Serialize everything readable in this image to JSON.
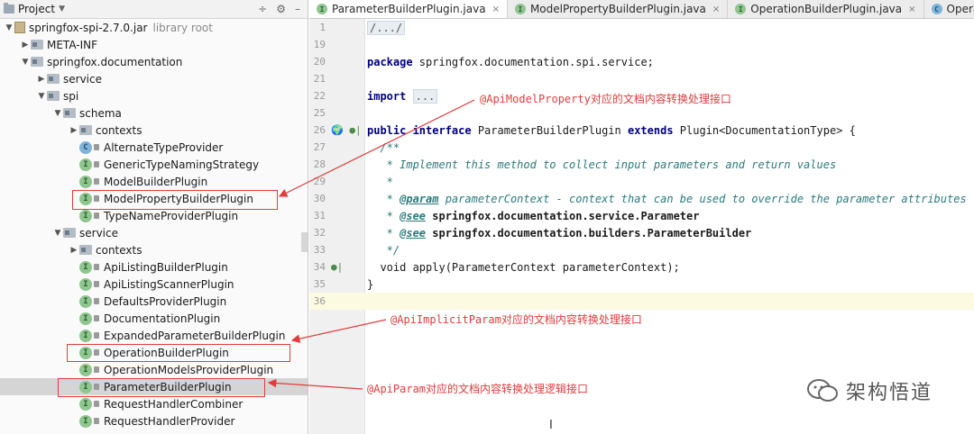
{
  "panel": {
    "title": "Project",
    "tools": [
      "÷",
      "⚙",
      "–"
    ]
  },
  "tree": [
    {
      "label": "springfox-spi-2.7.0.jar",
      "suffix": "library root",
      "type": "jar",
      "level": 0,
      "arrow": "down"
    },
    {
      "label": "META-INF",
      "type": "pkg",
      "level": 1,
      "arrow": "right"
    },
    {
      "label": "springfox.documentation",
      "type": "pkg",
      "level": 1,
      "arrow": "down"
    },
    {
      "label": "service",
      "type": "pkg",
      "level": 2,
      "arrow": "right"
    },
    {
      "label": "spi",
      "type": "pkg",
      "level": 2,
      "arrow": "down"
    },
    {
      "label": "schema",
      "type": "pkg",
      "level": 3,
      "arrow": "down"
    },
    {
      "label": "contexts",
      "type": "pkg",
      "level": 4,
      "arrow": "right"
    },
    {
      "label": "AlternateTypeProvider",
      "type": "class",
      "level": 4,
      "arrow": "none"
    },
    {
      "label": "GenericTypeNamingStrategy",
      "type": "interface",
      "level": 4,
      "arrow": "none"
    },
    {
      "label": "ModelBuilderPlugin",
      "type": "interface",
      "level": 4,
      "arrow": "none"
    },
    {
      "label": "ModelPropertyBuilderPlugin",
      "type": "interface",
      "level": 4,
      "arrow": "none"
    },
    {
      "label": "TypeNameProviderPlugin",
      "type": "interface",
      "level": 4,
      "arrow": "none"
    },
    {
      "label": "service",
      "type": "pkg",
      "level": 3,
      "arrow": "down"
    },
    {
      "label": "contexts",
      "type": "pkg",
      "level": 4,
      "arrow": "right"
    },
    {
      "label": "ApiListingBuilderPlugin",
      "type": "interface",
      "level": 4,
      "arrow": "none"
    },
    {
      "label": "ApiListingScannerPlugin",
      "type": "interface",
      "level": 4,
      "arrow": "none"
    },
    {
      "label": "DefaultsProviderPlugin",
      "type": "interface",
      "level": 4,
      "arrow": "none"
    },
    {
      "label": "DocumentationPlugin",
      "type": "interface",
      "level": 4,
      "arrow": "none"
    },
    {
      "label": "ExpandedParameterBuilderPlugin",
      "type": "interface",
      "level": 4,
      "arrow": "none"
    },
    {
      "label": "OperationBuilderPlugin",
      "type": "interface",
      "level": 4,
      "arrow": "none"
    },
    {
      "label": "OperationModelsProviderPlugin",
      "type": "interface",
      "level": 4,
      "arrow": "none"
    },
    {
      "label": "ParameterBuilderPlugin",
      "type": "interface",
      "level": 4,
      "arrow": "none",
      "selected": true
    },
    {
      "label": "RequestHandlerCombiner",
      "type": "interface",
      "level": 4,
      "arrow": "none"
    },
    {
      "label": "RequestHandlerProvider",
      "type": "interface",
      "level": 4,
      "arrow": "none"
    }
  ],
  "tabs": [
    {
      "label": "ParameterBuilderPlugin.java",
      "active": true,
      "icon": "interface"
    },
    {
      "label": "ModelPropertyBuilderPlugin.java",
      "active": false,
      "icon": "interface"
    },
    {
      "label": "OperationBuilderPlugin.java",
      "active": false,
      "icon": "interface"
    },
    {
      "label": "OperationImplicitParam",
      "active": false,
      "icon": "class"
    }
  ],
  "code_lines": [
    {
      "n": "1",
      "html": "<span class=\"fold\">/.../</span>"
    },
    {
      "n": "19",
      "html": ""
    },
    {
      "n": "20",
      "html": "<span class=\"kw\">package</span> springfox.documentation.spi.service;"
    },
    {
      "n": "21",
      "html": ""
    },
    {
      "n": "22",
      "html": "<span class=\"kw\">import</span> <span class=\"fold\">...</span>"
    },
    {
      "n": "25",
      "html": ""
    },
    {
      "n": "26",
      "html": "<span class=\"kw\">public interface</span> ParameterBuilderPlugin <span class=\"kw\">extends</span> Plugin&lt;DocumentationType&gt; {",
      "mark": "🌍 ●|"
    },
    {
      "n": "27",
      "html": "  <span class=\"doc\">/**</span>"
    },
    {
      "n": "28",
      "html": "<span class=\"doc\">   * Implement this method to collect input parameters and return values</span>"
    },
    {
      "n": "29",
      "html": "<span class=\"doc\">   *</span>"
    },
    {
      "n": "30",
      "html": "<span class=\"doc\">   * <span class=\"tag\">@param</span> parameterContext - context that can be used to override the parameter attributes</span>"
    },
    {
      "n": "31",
      "html": "<span class=\"doc\">   * <span class=\"tag\">@see</span> <span class=\"ref\">springfox.documentation.service.Parameter</span></span>"
    },
    {
      "n": "32",
      "html": "<span class=\"doc\">   * <span class=\"tag\">@see</span> <span class=\"ref\">springfox.documentation.builders.ParameterBuilder</span></span>"
    },
    {
      "n": "33",
      "html": "<span class=\"doc\">   */</span>"
    },
    {
      "n": "34",
      "html": "  void apply(ParameterContext parameterContext);",
      "mark": "●|"
    },
    {
      "n": "35",
      "html": "}"
    },
    {
      "n": "36",
      "html": "",
      "current": true
    }
  ],
  "annotations": {
    "model_property": "@ApiModelProperty对应的文档内容转换处理接口",
    "implicit_param": "@ApiImplicitParam对应的文档内容转换处理接口",
    "api_param": "@ApiParam对应的文档内容转换处理逻辑接口"
  },
  "watermark": {
    "text": "架构悟道"
  },
  "colors": {
    "annotation": "#e23c3c",
    "selection": "#d5d5d5",
    "keyword": "#000080",
    "doc": "#2b7a7a"
  }
}
